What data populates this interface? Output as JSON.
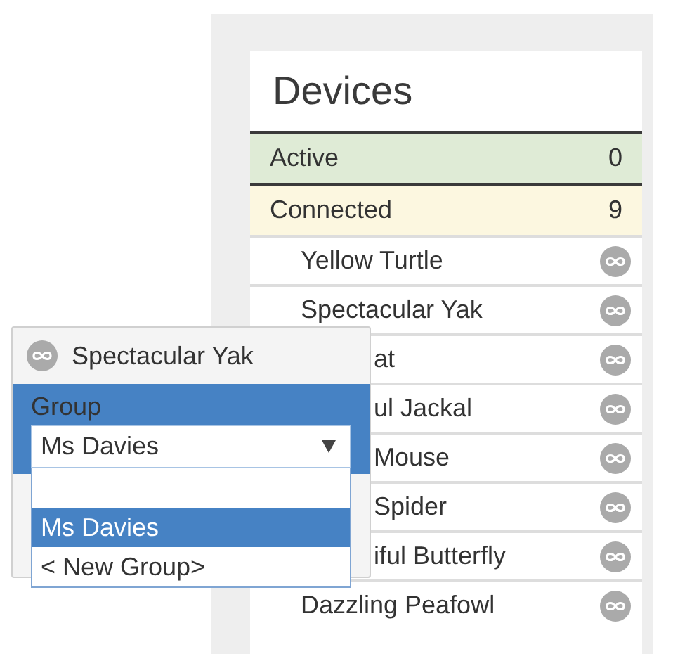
{
  "panel": {
    "title": "Devices",
    "summary": [
      {
        "kind": "active",
        "label": "Active",
        "count": "0"
      },
      {
        "kind": "connected",
        "label": "Connected",
        "count": "9"
      }
    ],
    "devices": [
      {
        "name": "Yellow Turtle",
        "clipped": false
      },
      {
        "name": "Spectacular Yak",
        "clipped": false
      },
      {
        "name": "at",
        "clipped": true
      },
      {
        "name": "ul Jackal",
        "clipped": true
      },
      {
        "name": "Mouse",
        "clipped": true
      },
      {
        "name": "Spider",
        "clipped": true
      },
      {
        "name": "iful Butterfly",
        "clipped": true
      },
      {
        "name": "Dazzling Peafowl",
        "clipped": false
      }
    ]
  },
  "popup": {
    "title": "Spectacular Yak",
    "field_label": "Group",
    "select": {
      "value": "Ms Davies",
      "expanded": true,
      "options": [
        {
          "kind": "blank",
          "selected": false
        },
        {
          "kind": "option",
          "label": "Ms Davies",
          "selected": true
        },
        {
          "kind": "option",
          "label": "< New Group>",
          "selected": false
        }
      ]
    }
  }
}
